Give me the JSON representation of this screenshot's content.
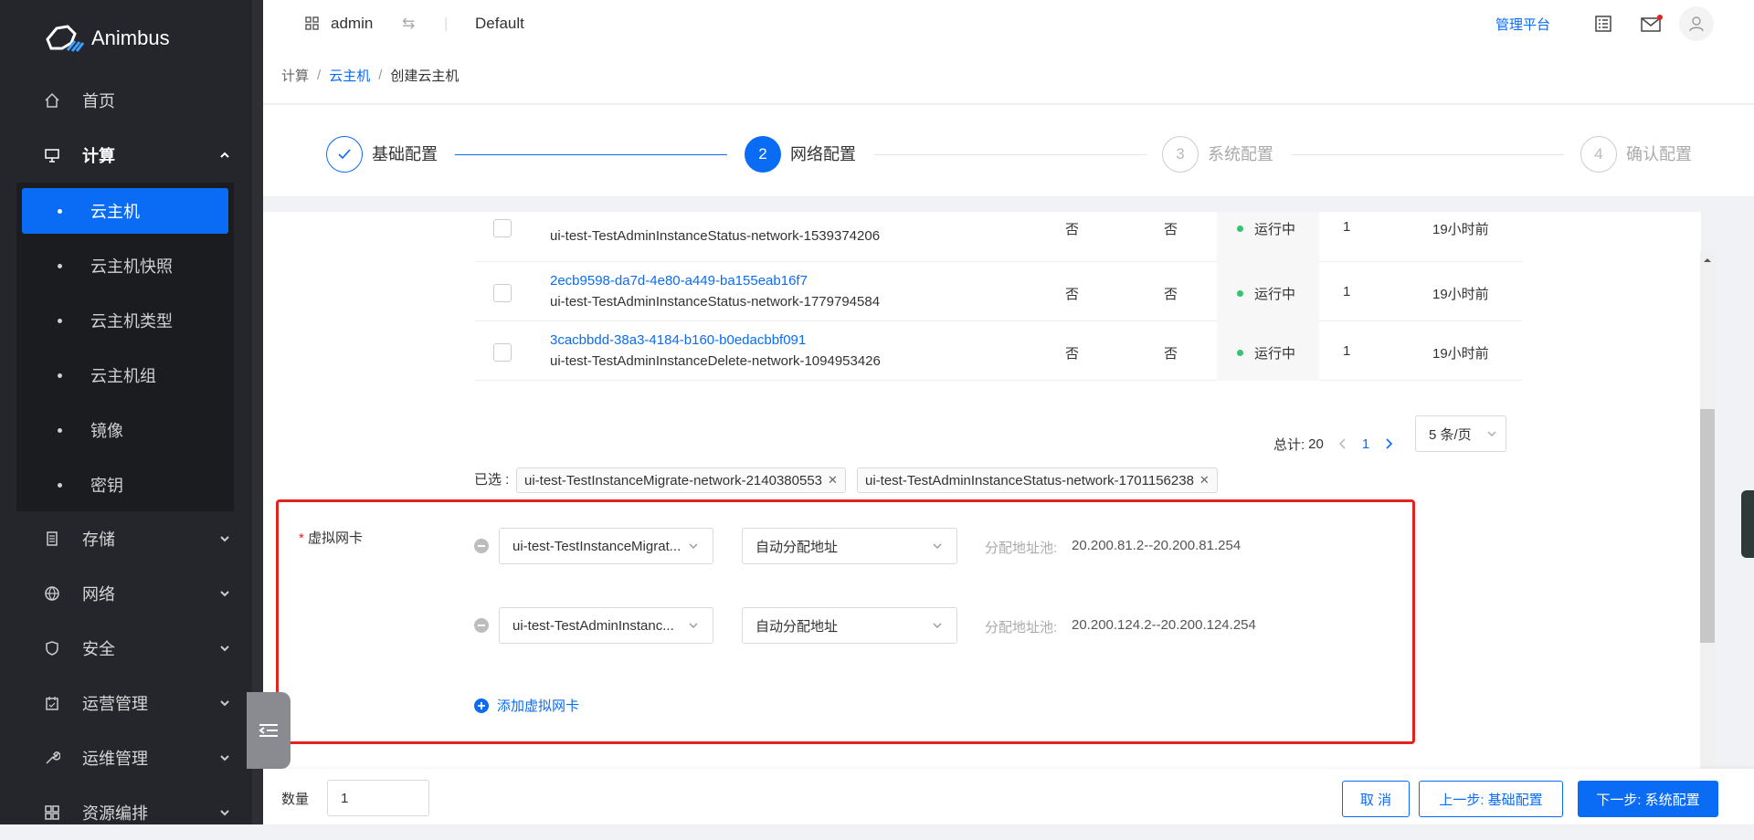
{
  "brand": {
    "name": "Animbus"
  },
  "sidebar": {
    "items": [
      {
        "label": "首页",
        "icon": "home-icon"
      },
      {
        "label": "计算",
        "icon": "monitor-icon"
      },
      {
        "label": "存储",
        "icon": "storage-icon"
      },
      {
        "label": "网络",
        "icon": "globe-icon"
      },
      {
        "label": "安全",
        "icon": "shield-icon"
      },
      {
        "label": "运营管理",
        "icon": "calendar-icon"
      },
      {
        "label": "运维管理",
        "icon": "wrench-icon"
      },
      {
        "label": "资源编排",
        "icon": "grid-icon"
      }
    ],
    "compute_sub": [
      "云主机",
      "云主机快照",
      "云主机类型",
      "云主机组",
      "镜像",
      "密钥"
    ]
  },
  "topbar": {
    "user": "admin",
    "project": "Default",
    "platform_link": "管理平台"
  },
  "breadcrumb": {
    "root": "计算",
    "parent": "云主机",
    "current": "创建云主机"
  },
  "steps": [
    {
      "num": "1",
      "label": "基础配置",
      "status": "done"
    },
    {
      "num": "2",
      "label": "网络配置",
      "status": "active"
    },
    {
      "num": "3",
      "label": "系统配置",
      "status": "pending"
    },
    {
      "num": "4",
      "label": "确认配置",
      "status": "pending"
    }
  ],
  "networks": {
    "partial_row": {
      "name": "ui-test-TestAdminInstanceStatus-network-1539374206",
      "shared": "否",
      "external": "否",
      "status": "运行中",
      "subnets": "1",
      "created": "19小时前"
    },
    "rows": [
      {
        "id": "2ecb9598-da7d-4e80-a449-ba155eab16f7",
        "name": "ui-test-TestAdminInstanceStatus-network-1779794584",
        "shared": "否",
        "external": "否",
        "status": "运行中",
        "subnets": "1",
        "created": "19小时前"
      },
      {
        "id": "3cacbbdd-38a3-4184-b160-b0edacbbf091",
        "name": "ui-test-TestAdminInstanceDelete-network-1094953426",
        "shared": "否",
        "external": "否",
        "status": "运行中",
        "subnets": "1",
        "created": "19小时前"
      }
    ],
    "pagination": {
      "total_label": "总计:",
      "total": "20",
      "page": "1",
      "page_size": "5 条/页"
    },
    "selected_label": "已选 :",
    "selected": [
      "ui-test-TestInstanceMigrate-network-2140380553",
      "ui-test-TestAdminInstanceStatus-network-1701156238"
    ]
  },
  "vnic": {
    "label": "虚拟网卡",
    "required_mark": "*",
    "entries": [
      {
        "network": "ui-test-TestInstanceMigrat...",
        "mode": "自动分配地址",
        "pool_label": "分配地址池:",
        "pool": "20.200.81.2--20.200.81.254"
      },
      {
        "network": "ui-test-TestAdminInstanc...",
        "mode": "自动分配地址",
        "pool_label": "分配地址池:",
        "pool": "20.200.124.2--20.200.124.254"
      }
    ],
    "add_label": "添加虚拟网卡"
  },
  "footer": {
    "count_label": "数量",
    "count": "1",
    "cancel": "取 消",
    "prev": "上一步: 基础配置",
    "next": "下一步: 系统配置"
  },
  "colors": {
    "primary": "#0a6cf5",
    "sidebar": "#25262c",
    "highlight": "#e32222",
    "running": "#35c46b"
  }
}
